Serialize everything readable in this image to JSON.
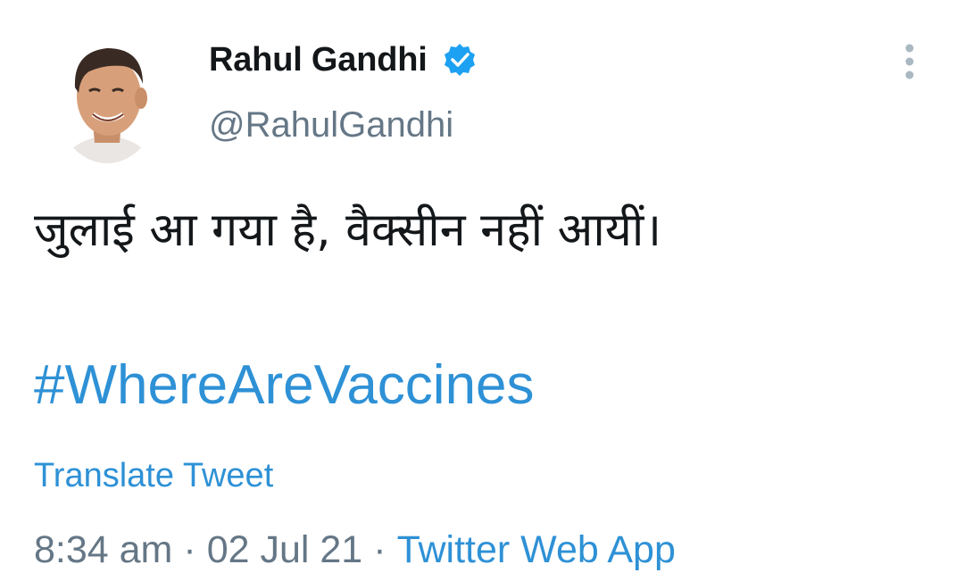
{
  "author": {
    "display_name": "Rahul Gandhi",
    "handle": "@RahulGandhi",
    "verified_icon": "verified-badge-icon"
  },
  "menu": {
    "icon": "more-vertical-icon"
  },
  "tweet": {
    "text": "जुलाई आ गया है, वैक्सीन नहीं आयीं।",
    "hashtag": "#WhereAreVaccines",
    "translate_label": "Translate Tweet",
    "time": "8:34 am",
    "date": "02 Jul 21",
    "separator": "·",
    "source": "Twitter Web App"
  },
  "colors": {
    "link": "#2e91d6",
    "text": "#14171a",
    "muted": "#657786",
    "verified": "#1da1f2"
  }
}
